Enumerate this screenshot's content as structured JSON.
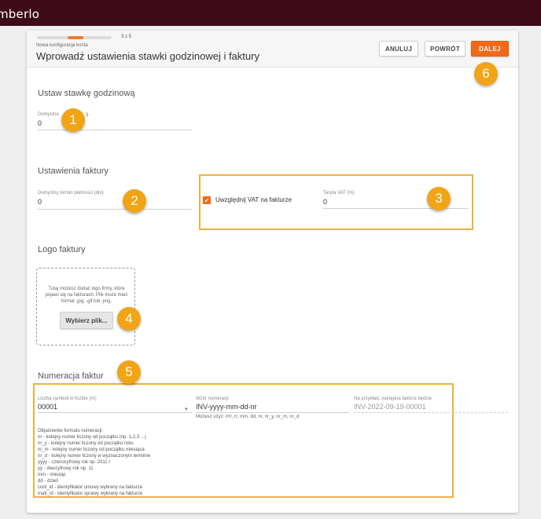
{
  "app": {
    "brand": "mberlo"
  },
  "header": {
    "step_count": "3 z 5",
    "breadcrumb": "Nowa konfiguracja konta",
    "title": "Wprowadź ustawienia stawki godzinowej i faktury",
    "progress_fraction": 0.2,
    "buttons": {
      "cancel": "ANULUJ",
      "back": "POWRÓT",
      "next": "DALEJ"
    }
  },
  "hourly_rate": {
    "section_title": "Ustaw stawkę godzinową",
    "label": "Domyślna",
    "label_tail": "g.",
    "value": "0"
  },
  "invoice_settings": {
    "section_title": "Ustawienia faktury",
    "payment_term_label": "Domyślny termin płatności (dni)",
    "payment_term_value": "0",
    "vat_checkbox_label": "Uwzględnij VAT na fakturze",
    "vat_checked": true,
    "vat_rate_label": "Taryfa VAT (%)",
    "vat_rate_value": "0"
  },
  "invoice_logo": {
    "section_title": "Logo faktury",
    "hint": "Tutaj możesz dodać logo firmy, które pojawi się na fakturach. Plik może mieć format .jpg, .gif lub .png.",
    "choose_file_button": "Wybierz plik..."
  },
  "numbering": {
    "section_title": "Numeracja faktur",
    "digits_label": "Liczba symboli w liczbie (nr)",
    "digits_value": "00001",
    "pattern_label": "Wzór numeracji",
    "pattern_value": "INV-yyyy-mm-dd-nr",
    "pattern_hint": "Możesz użyć: rrrr, rr, mm, dd, nr, nr_y, nr_m, nr_d",
    "example_label": "Na przykład, następna faktura będzie",
    "example_value": "INV-2022-09-19-00001",
    "format_help": [
      "Objaśnienie formatu numeracji:",
      "nr - kolejny numer liczony od początku (np. 1,2,3 ...)",
      "nr_y - kolejny numer liczony od początku roku",
      "nr_m - kolejny numer liczony od początku miesiąca",
      "nr_d - kolejny numer liczony w wyznaczonym terminie",
      "yyyy - czterocyfrowy rok np. 2011 r",
      "yy - dwucyfrowy rok np. 11",
      "mm - miesiąc",
      "dd - dzień",
      "cont_id - identyfikator umowy wybrany na fakturze",
      "matt_id - identyfikator sprawy wybrany na fakturze"
    ]
  },
  "callouts": [
    "1",
    "2",
    "3",
    "4",
    "5",
    "6"
  ],
  "colors": {
    "accent": "#f06a1a",
    "callout": "#f2a417",
    "topbar": "#3d0b17",
    "highlight": "#f0b13a"
  }
}
